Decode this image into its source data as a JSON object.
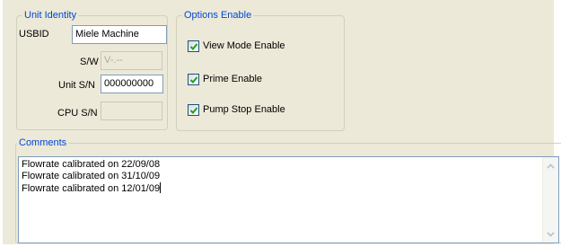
{
  "unit_identity": {
    "legend": "Unit Identity",
    "usbid_label": "USBID",
    "usbid_value": "Miele Machine",
    "sw_label": "S/W",
    "sw_value": "V-.--",
    "unit_sn_label": "Unit S/N",
    "unit_sn_value": "000000000",
    "cpu_sn_label": "CPU S/N",
    "cpu_sn_value": ""
  },
  "options_enable": {
    "legend": "Options Enable",
    "items": [
      {
        "label": "View Mode Enable",
        "checked": true
      },
      {
        "label": "Prime Enable",
        "checked": true
      },
      {
        "label": "Pump Stop Enable",
        "checked": true
      }
    ]
  },
  "comments": {
    "legend": "Comments",
    "lines": [
      "Flowrate calibrated on 22/09/08",
      "Flowrate calibrated on 31/10/09",
      "Flowrate calibrated on 12/01/09"
    ]
  },
  "colors": {
    "panel": "#ece9d8",
    "legend_text": "#0046d5",
    "input_border": "#7f9db9",
    "check_green": "#21a121"
  },
  "icons": {
    "checkmark": "checkmark-icon",
    "scroll_up": "scroll-up-arrow-icon",
    "scroll_down": "scroll-down-arrow-icon"
  }
}
